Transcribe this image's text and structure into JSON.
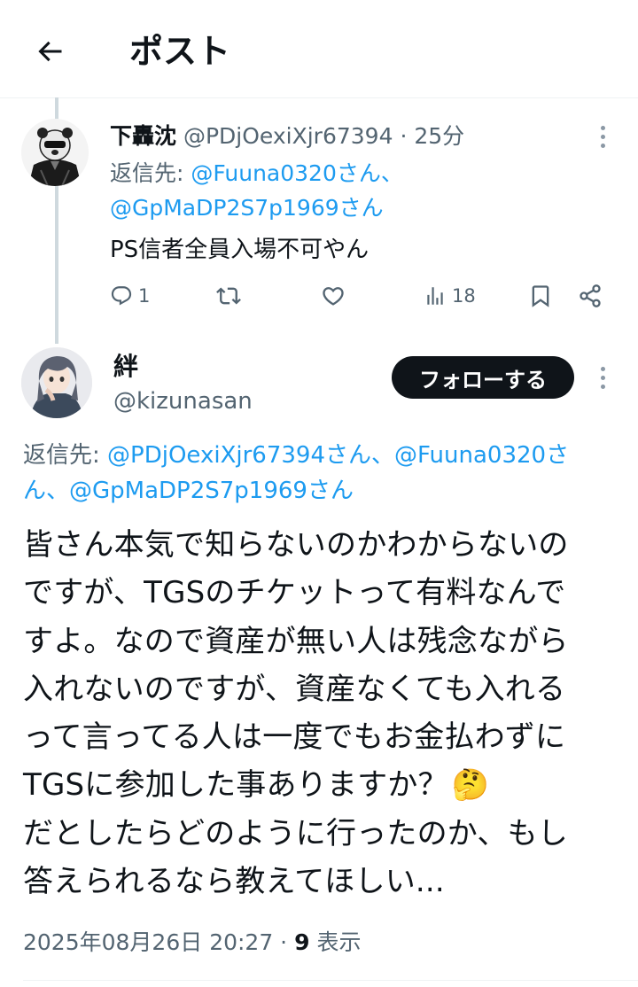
{
  "header": {
    "title": "ポスト"
  },
  "reply_tweet": {
    "display_name": "下轟沈",
    "handle": "@PDjOexiXjr67394",
    "time": "· 25分",
    "reply_prefix": "返信先: ",
    "reply_line1": "@Fuuna0320さん、",
    "reply_line2": "@GpMaDP2S7p1969さん",
    "text": "PS信者全員入場不可やん",
    "actions": {
      "reply_count": "1",
      "retweet_count": "",
      "like_count": "",
      "views_count": "18"
    }
  },
  "main_tweet": {
    "display_name": "絆",
    "handle": "@kizunasan",
    "follow_label": "フォローする",
    "reply_prefix": "返信先: ",
    "reply_line1": "@PDjOexiXjr67394さん、@Fuuna0320さ",
    "reply_line2": "ん、@GpMaDP2S7p1969さん",
    "text_lines": [
      "皆さん本気で知らないのかわからないの",
      "ですが、TGSのチケットって有料なんで",
      "すよ。なので資産が無い人は残念ながら",
      "入れないのですが、資産なくても入れる",
      "って言ってる人は一度でもお金払わずに",
      "TGSに参加した事ありますか？",
      "だとしたらどのように行ったのか、もし",
      "答えられるなら教えてほしい..."
    ],
    "emoji": "🤔",
    "timestamp": "2025年08月26日 20:27 · ",
    "views_count": "9",
    "views_label": " 表示"
  },
  "colors": {
    "link": "#1d9bf0",
    "secondary": "#536471",
    "button_bg": "#0f1419"
  }
}
